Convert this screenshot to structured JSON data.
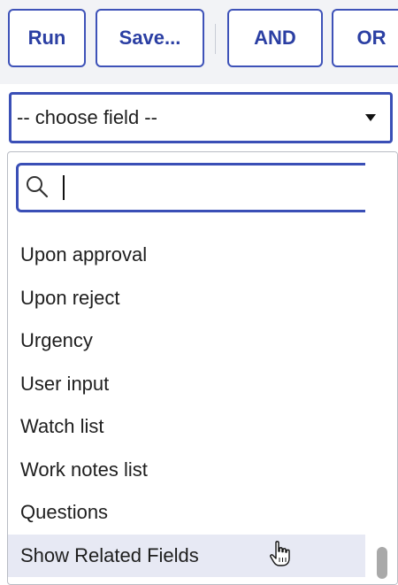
{
  "toolbar": {
    "run_label": "Run",
    "save_label": "Save...",
    "and_label": "AND",
    "or_label": "OR"
  },
  "field_select": {
    "value": "-- choose field --",
    "icon": "caret-down-icon"
  },
  "dropdown": {
    "search": {
      "value": "",
      "placeholder": "",
      "icon": "search-icon"
    },
    "options": [
      "Upon approval",
      "Upon reject",
      "Urgency",
      "User input",
      "Watch list",
      "Work notes list",
      "Questions",
      "Show Related Fields"
    ],
    "highlighted_option": "Show Related Fields"
  },
  "colors": {
    "accent": "#3a4fb6",
    "button_text": "#2b3fa3",
    "toolbar_bg": "#f2f3f6",
    "highlight_bg": "#e7e9f4",
    "scrollbar_thumb": "#a9a9a9"
  }
}
